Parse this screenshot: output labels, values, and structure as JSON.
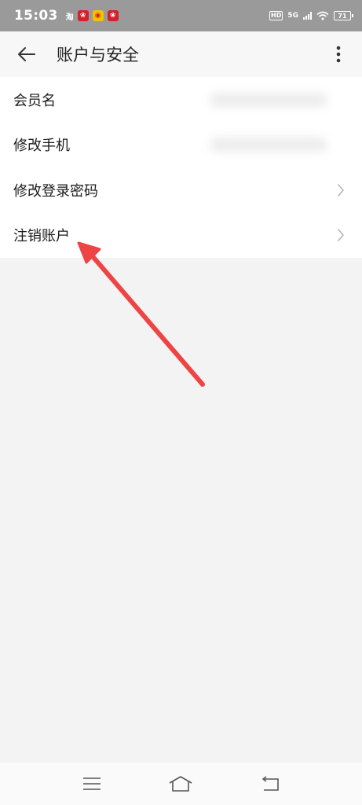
{
  "status_bar": {
    "time": "15:03",
    "notifications": [
      "taobao-icon",
      "app-icon",
      "weibo-icon",
      "app-icon"
    ],
    "taobao_glyph": "淘",
    "hd": "HD",
    "network": "5G",
    "battery": "71"
  },
  "header": {
    "title": "账户与安全",
    "back_icon": "back-arrow-icon",
    "more_icon": "more-vertical-icon"
  },
  "list": {
    "items": [
      {
        "label": "会员名",
        "type": "value"
      },
      {
        "label": "修改手机",
        "type": "value"
      },
      {
        "label": "修改登录密码",
        "type": "link"
      },
      {
        "label": "注销账户",
        "type": "link"
      }
    ]
  },
  "annotation": {
    "color": "#ee4444",
    "target": "注销账户"
  },
  "nav_bar": {
    "buttons": [
      "menu-icon",
      "home-icon",
      "back-icon"
    ]
  },
  "colors": {
    "status_bar": "#9a9a9a",
    "header_bg": "#f7f7f7",
    "page_bg": "#f3f3f3",
    "list_bg": "#ffffff"
  }
}
